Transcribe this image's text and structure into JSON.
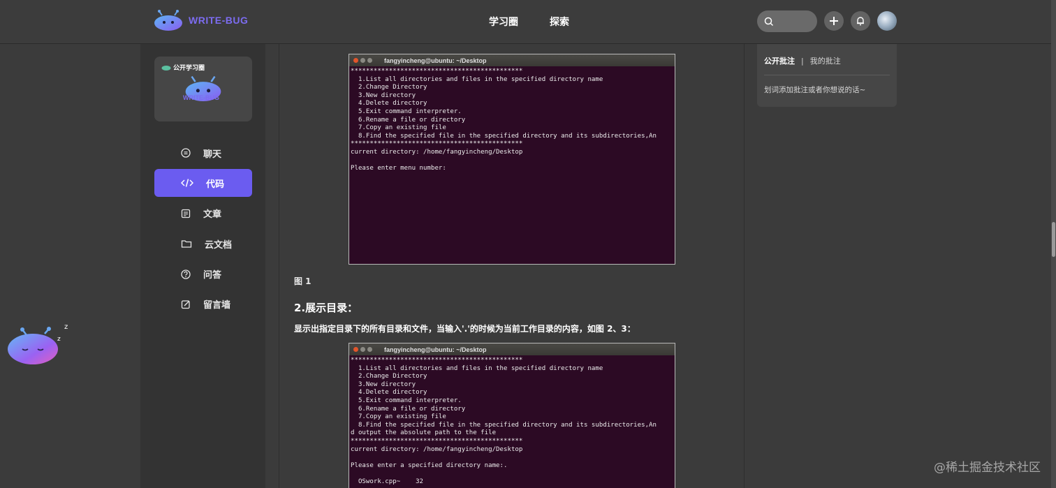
{
  "header": {
    "brand": "WRITE-BUG",
    "nav": [
      "学习圈",
      "探索"
    ],
    "search": {
      "placeholder": ""
    }
  },
  "sidebar": {
    "circle_label": "公开学习圈",
    "circle_logo_text": "WRITE-BUG",
    "items": [
      {
        "label": "聊天",
        "icon": "chat-icon",
        "active": false
      },
      {
        "label": "代码",
        "icon": "code-icon",
        "active": true
      },
      {
        "label": "文章",
        "icon": "article-icon",
        "active": false
      },
      {
        "label": "云文档",
        "icon": "folder-icon",
        "active": false
      },
      {
        "label": "问答",
        "icon": "question-icon",
        "active": false
      },
      {
        "label": "留言墙",
        "icon": "edit-icon",
        "active": false
      }
    ]
  },
  "main": {
    "terminal1": {
      "title": "fangyincheng@ubuntu: ~/Desktop",
      "text": "*********************************************\n  1.List all directories and files in the specified directory name\n  2.Change Directory\n  3.New directory\n  4.Delete directory\n  5.Exit command interpreter.\n  6.Rename a file or directory\n  7.Copy an existing file\n  8.Find the specified file in the specified directory and its subdirectories,An\n*********************************************\ncurrent directory: /home/fangyincheng/Desktop\n\nPlease enter menu number:"
    },
    "figure_caption": "图 1",
    "section_title": "2.展示目录：",
    "section_text": "显示出指定目录下的所有目录和文件，当输入'.'的时候为当前工作目录的内容，如图 2、3：",
    "terminal2": {
      "title": "fangyincheng@ubuntu: ~/Desktop",
      "text": "*********************************************\n  1.List all directories and files in the specified directory name\n  2.Change Directory\n  3.New directory\n  4.Delete directory\n  5.Exit command interpreter.\n  6.Rename a file or directory\n  7.Copy an existing file\n  8.Find the specified file in the specified directory and its subdirectories,An\nd output the absolute path to the file\n*********************************************\ncurrent directory: /home/fangyincheng/Desktop\n\nPlease enter a specified directory name:.\n\n  OSwork.cpp~    32"
    }
  },
  "annotation": {
    "tab_public": "公开批注",
    "separator": "|",
    "tab_mine": "我的批注",
    "hint": "划词添加批注或者你想说的话~"
  },
  "watermark": "@稀土掘金技术社区",
  "colors": {
    "accent": "#6b5cf0",
    "brand": "#7c6cf0",
    "terminal_bg": "#2c0a24"
  }
}
